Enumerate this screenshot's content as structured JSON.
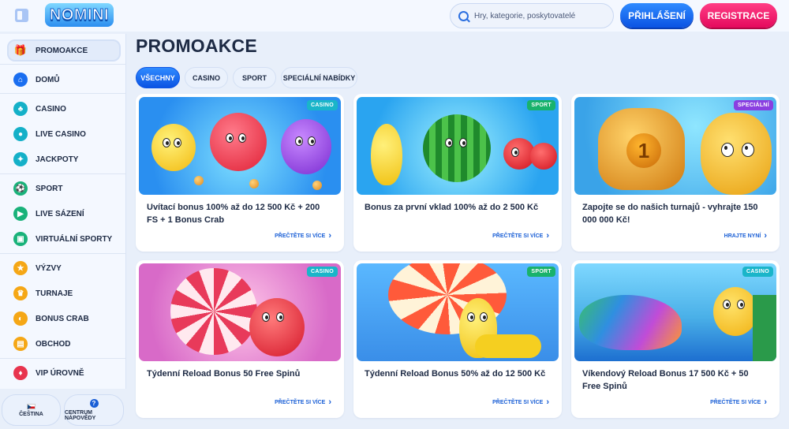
{
  "header": {
    "logo": "NOMINI",
    "search_placeholder": "Hry, kategorie, poskytovatelé",
    "login_label": "PŘIHLÁŠENÍ",
    "register_label": "REGISTRACE"
  },
  "sidebar": {
    "items": [
      {
        "label": "PROMOAKCE",
        "icon": "gift-icon"
      },
      {
        "label": "DOMŮ",
        "icon": "home-icon"
      },
      {
        "label": "CASINO",
        "icon": "casino-icon"
      },
      {
        "label": "LIVE CASINO",
        "icon": "live-casino-icon"
      },
      {
        "label": "JACKPOTY",
        "icon": "jackpot-icon"
      },
      {
        "label": "SPORT",
        "icon": "sport-icon"
      },
      {
        "label": "LIVE SÁZENÍ",
        "icon": "live-betting-icon"
      },
      {
        "label": "VIRTUÁLNÍ SPORTY",
        "icon": "virtual-sports-icon"
      },
      {
        "label": "VÝZVY",
        "icon": "challenges-icon"
      },
      {
        "label": "TURNAJE",
        "icon": "trophy-icon"
      },
      {
        "label": "BONUS CRAB",
        "icon": "bonus-crab-icon"
      },
      {
        "label": "OBCHOD",
        "icon": "shop-icon"
      },
      {
        "label": "VIP ÚROVNĚ",
        "icon": "vip-icon"
      }
    ],
    "language_label": "ČEŠTINA",
    "help_label": "CENTRUM NÁPOVĚDY"
  },
  "main": {
    "title": "PROMOAKCE",
    "tabs": [
      "VŠECHNY",
      "CASINO",
      "SPORT",
      "SPECIÁLNÍ NABÍDKY"
    ],
    "cards": [
      {
        "badge": "CASINO",
        "title": "Uvítací bonus 100% až do 12 500 Kč + 200 FS + 1 Bonus Crab",
        "link": "PŘEČTĚTE SI VÍCE"
      },
      {
        "badge": "SPORT",
        "title": "Bonus za první vklad 100% až do 2 500 Kč",
        "link": "PŘEČTĚTE SI VÍCE"
      },
      {
        "badge": "SPECIÁLNÍ",
        "title": "Zapojte se do našich turnajů - vyhrajte 150 000 000 Kč!",
        "link": "HRAJTE NYNÍ"
      },
      {
        "badge": "CASINO",
        "title": "Týdenní Reload Bonus 50 Free Spinů",
        "link": "PŘEČTĚTE SI VÍCE"
      },
      {
        "badge": "SPORT",
        "title": "Týdenní Reload Bonus 50% až do 12 500 Kč",
        "link": "PŘEČTĚTE SI VÍCE"
      },
      {
        "badge": "CASINO",
        "title": "Víkendový Reload Bonus 17 500 Kč + 50 Free Spinů",
        "link": "PŘEČTĚTE SI VÍCE"
      }
    ]
  },
  "colors": {
    "primary_blue": "#0b53e3",
    "register_pink": "#e50a5d",
    "badge_casino": "#1ab5c9",
    "badge_sport": "#19b26b",
    "badge_special": "#8a3fe0"
  }
}
